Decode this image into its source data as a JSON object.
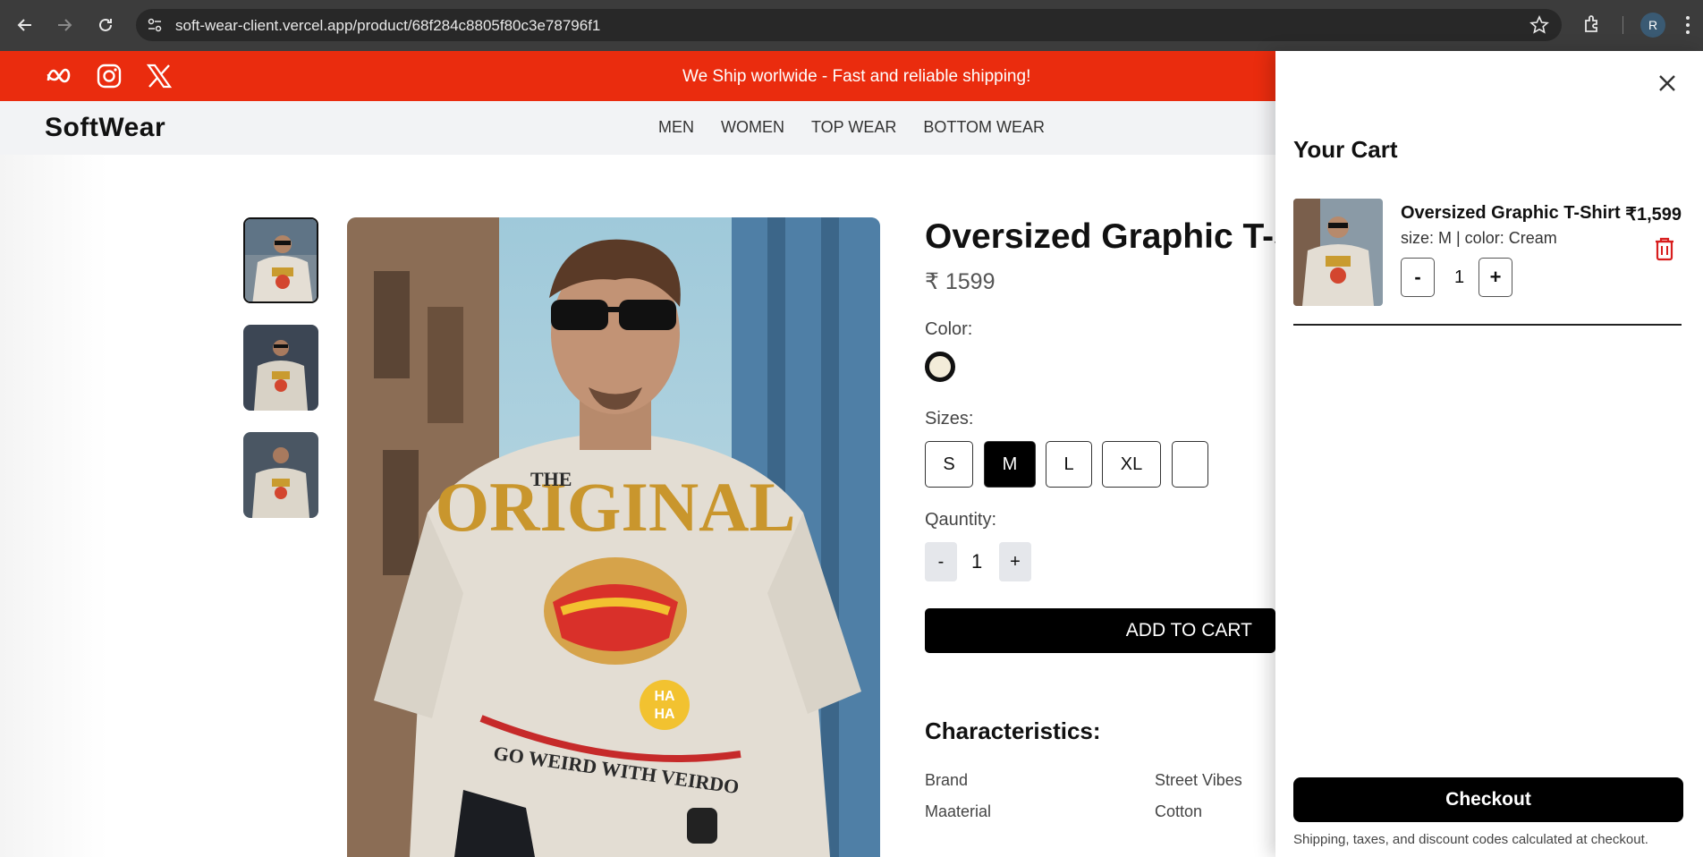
{
  "browser": {
    "url": "soft-wear-client.vercel.app/product/68f284c8805f80c3e78796f1",
    "profile_initial": "R"
  },
  "announcement": {
    "message": "We Ship worlwide - Fast and reliable shipping!",
    "social_icons": [
      "meta-icon",
      "instagram-icon",
      "x-icon"
    ],
    "bg_color": "#ea2c0e"
  },
  "header": {
    "logo": "SoftWear",
    "nav": [
      "MEN",
      "WOMEN",
      "TOP WEAR",
      "BOTTOM WEAR"
    ]
  },
  "product": {
    "title": "Oversized Graphic T-Shirt",
    "price": "₹ 1599",
    "color_label": "Color:",
    "sizes_label": "Sizes:",
    "sizes": [
      "S",
      "M",
      "L",
      "XL",
      ""
    ],
    "selected_size": "M",
    "quantity_label": "Qauntity:",
    "quantity": "1",
    "minus": "-",
    "plus": "+",
    "add_to_cart": "ADD TO CART",
    "characteristics_title": "Characteristics:",
    "characteristics": [
      {
        "key": "Brand",
        "value": "Street Vibes"
      },
      {
        "key": "Maaterial",
        "value": "Cotton"
      }
    ]
  },
  "cart": {
    "title": "Your Cart",
    "item": {
      "name": "Oversized Graphic T-Shirt",
      "price": "₹1,599",
      "meta": "size: M | color: Cream",
      "quantity": "1",
      "minus": "-",
      "plus": "+"
    },
    "checkout": "Checkout",
    "note": "Shipping, taxes, and discount codes calculated at checkout."
  }
}
